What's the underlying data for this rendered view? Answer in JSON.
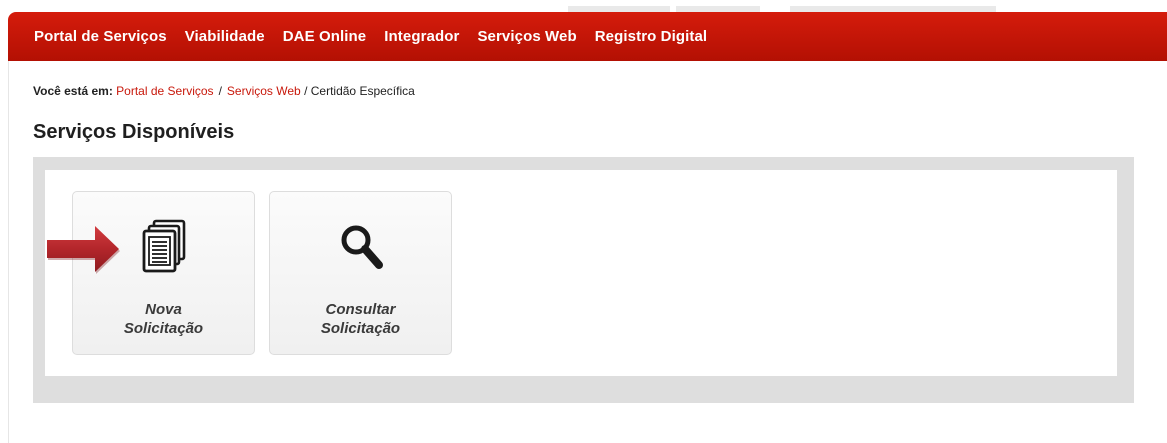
{
  "navbar": {
    "items": [
      {
        "label": "Portal de Serviços"
      },
      {
        "label": "Viabilidade"
      },
      {
        "label": "DAE Online"
      },
      {
        "label": "Integrador"
      },
      {
        "label": "Serviços Web"
      },
      {
        "label": "Registro Digital"
      }
    ],
    "color": "#c8180b"
  },
  "breadcrumb": {
    "prefix": "Você está em:",
    "links": [
      "Portal de Serviços",
      "Serviços Web"
    ],
    "separator": "/",
    "current": "Certidão Específica"
  },
  "page_title": "Serviços Disponíveis",
  "services": [
    {
      "line1": "Nova",
      "line2": "Solicitação",
      "icon": "document-icon"
    },
    {
      "line1": "Consultar",
      "line2": "Solicitação",
      "icon": "magnifier-icon"
    }
  ],
  "annotation": {
    "icon": "pointer-arrow-icon",
    "color": "#c0282d"
  }
}
